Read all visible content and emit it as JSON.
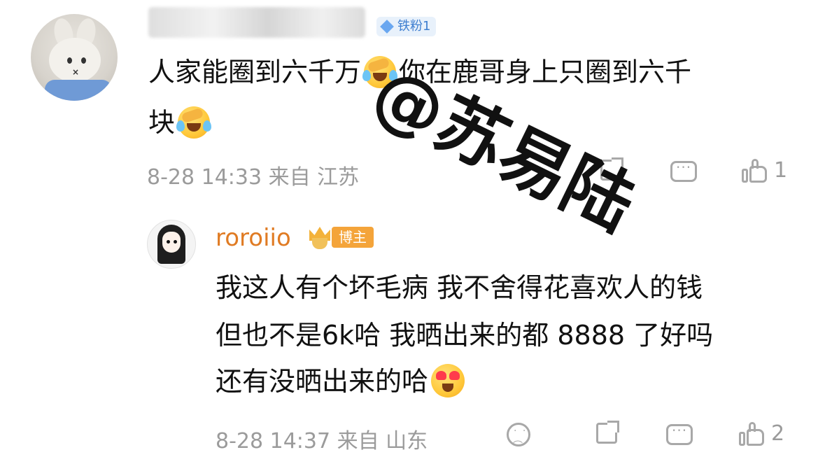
{
  "comment": {
    "author_badge": "铁粉1",
    "text_line1_a": "人家能圈到六千万",
    "text_line1_b": "你在鹿哥身上只圈到六千",
    "text_line2": "块",
    "timestamp": "8-28 14:33",
    "location": "来自 江苏",
    "like_count": "1"
  },
  "reply": {
    "author": "roroiio",
    "author_badge": "博主",
    "line1": "我这人有个坏毛病 我不舍得花喜欢人的钱",
    "line2": "但也不是6k哈 我晒出来的都 8888 了好吗",
    "line3": "还有没晒出来的哈",
    "timestamp": "8-28 14:37",
    "location": "来自 山东",
    "like_count": "2"
  },
  "watermark": {
    "text": "@苏易陆"
  },
  "icons": {
    "share": "share-icon",
    "comment": "comment-icon",
    "like": "like-icon",
    "dislike": "sad-face-icon",
    "emoji_laugh_cry": "laugh-cry-emoji",
    "emoji_heart_eyes": "heart-eyes-emoji"
  },
  "colors": {
    "author_name": "#e07b23",
    "meta_text": "#9b9b9b",
    "fan_badge": "#3f7fd0",
    "host_badge": "#f4a43a"
  }
}
